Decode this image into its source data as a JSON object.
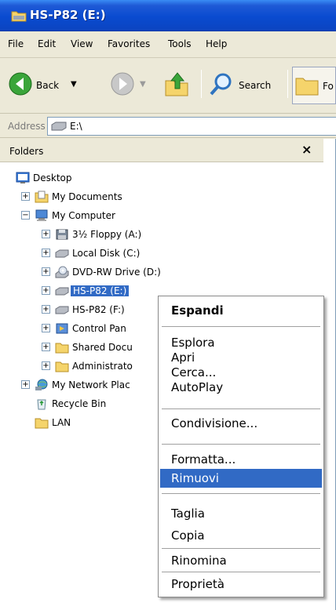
{
  "window": {
    "title": "HS-P82 (E:)"
  },
  "menubar": {
    "items": [
      "File",
      "Edit",
      "View",
      "Favorites",
      "Tools",
      "Help"
    ]
  },
  "toolbar": {
    "back_label": "Back",
    "search_label": "Search",
    "folders_label": "Fo"
  },
  "address": {
    "label": "Address",
    "value": "E:\\"
  },
  "folders_pane": {
    "title": "Folders",
    "close_glyph": "×",
    "tree": [
      {
        "label": "Desktop",
        "icon": "desktop-icon"
      },
      {
        "label": "My Documents",
        "icon": "my-documents-icon",
        "expander": "+"
      },
      {
        "label": "My Computer",
        "icon": "my-computer-icon",
        "expander": "−"
      },
      {
        "label": "3½ Floppy (A:)",
        "icon": "floppy-icon",
        "expander": "+"
      },
      {
        "label": "Local Disk (C:)",
        "icon": "drive-icon",
        "expander": "+"
      },
      {
        "label": "DVD-RW Drive (D:)",
        "icon": "dvd-icon",
        "expander": "+"
      },
      {
        "label": "HS-P82 (E:)",
        "icon": "drive-icon",
        "expander": "+",
        "selected": true
      },
      {
        "label": "HS-P82 (F:)",
        "icon": "drive-icon",
        "expander": "+"
      },
      {
        "label": "Control Pan",
        "icon": "control-panel-icon",
        "expander": "+"
      },
      {
        "label": "Shared Docu",
        "icon": "folder-icon",
        "expander": "+"
      },
      {
        "label": "Administrato",
        "icon": "folder-icon",
        "expander": "+"
      },
      {
        "label": "My Network Plac",
        "icon": "network-icon",
        "expander": "+"
      },
      {
        "label": "Recycle Bin",
        "icon": "recycle-bin-icon"
      },
      {
        "label": "LAN",
        "icon": "folder-icon"
      }
    ]
  },
  "context_menu": {
    "items": [
      {
        "label": "Espandi",
        "bold": true
      },
      {
        "label": "Esplora"
      },
      {
        "label": "Apri"
      },
      {
        "label": "Cerca..."
      },
      {
        "label": "AutoPlay"
      },
      {
        "label": "Condivisione..."
      },
      {
        "label": "Formatta..."
      },
      {
        "label": "Rimuovi",
        "highlighted": true
      },
      {
        "label": "Taglia"
      },
      {
        "label": "Copia"
      },
      {
        "label": "Rinomina"
      },
      {
        "label": "Proprietà"
      }
    ]
  },
  "colors": {
    "title_bar": "#0a4bd0",
    "selection": "#316ac5",
    "chrome": "#ece9d8"
  }
}
